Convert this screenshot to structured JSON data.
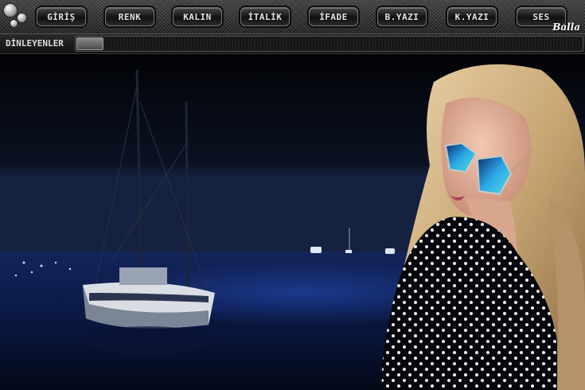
{
  "toolbar": {
    "buttons": [
      {
        "label": "GİRİŞ"
      },
      {
        "label": "RENK"
      },
      {
        "label": "KALIN"
      },
      {
        "label": "İTALİK"
      },
      {
        "label": "İFADE"
      },
      {
        "label": "B.YAZI"
      },
      {
        "label": "K.YAZI"
      },
      {
        "label": "SES"
      }
    ],
    "brand": "Balla"
  },
  "listeners": {
    "label": "DİNLEYENLER"
  },
  "colors": {
    "night_sky": "#05070c",
    "sea": "#0c1a45",
    "button_text": "#e6e6e6"
  },
  "icons": [
    "window-dots-icon"
  ]
}
